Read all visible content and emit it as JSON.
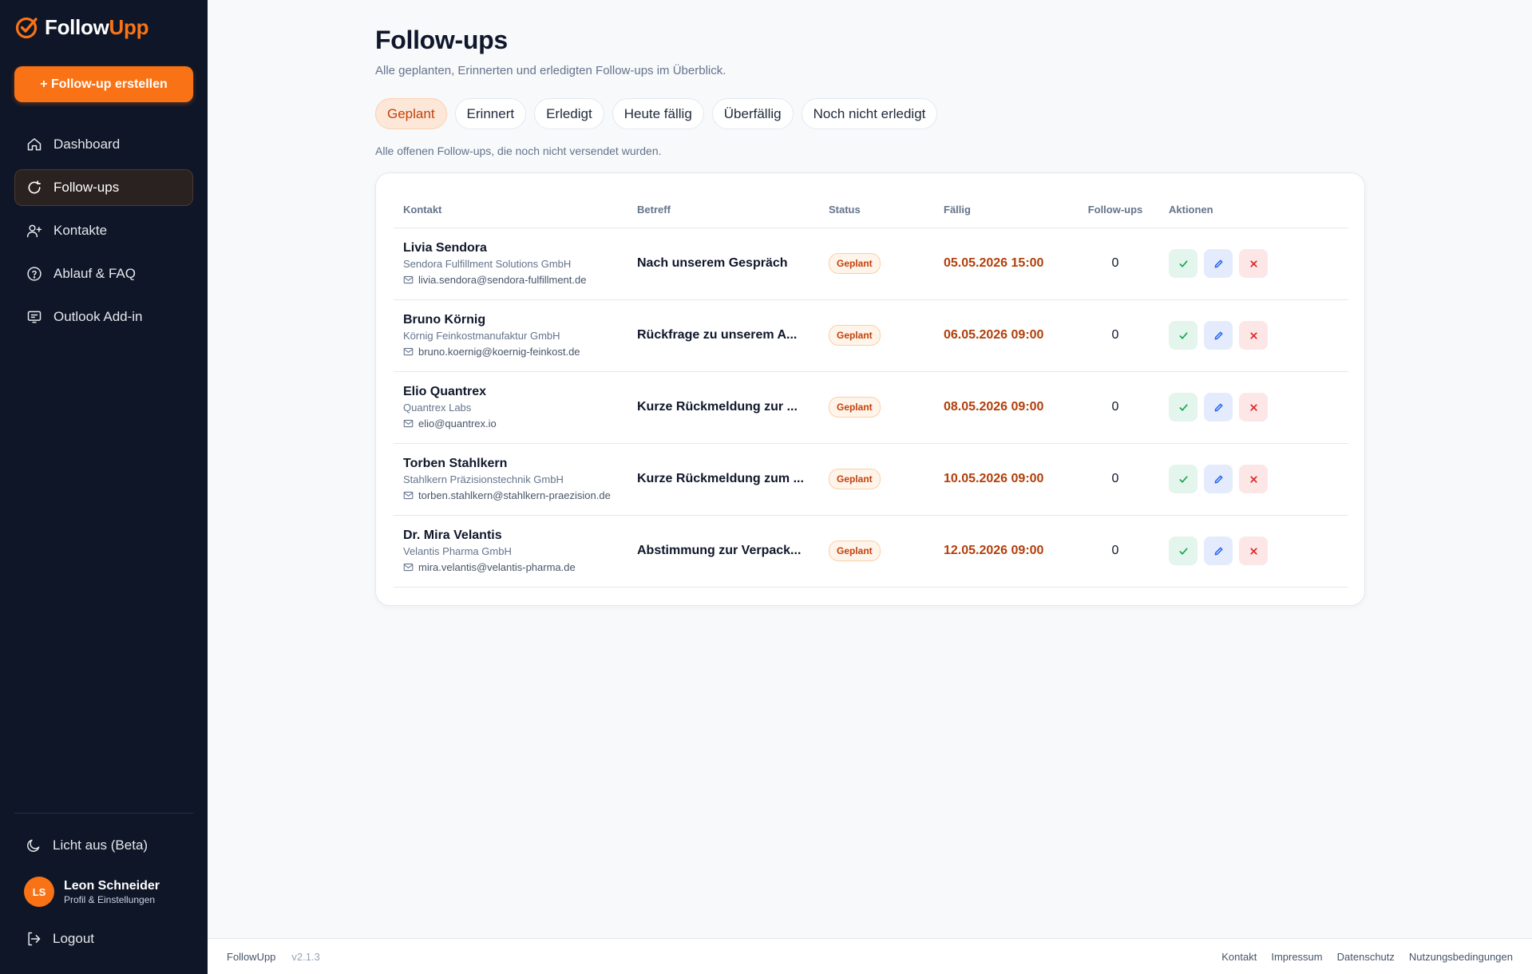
{
  "brand": {
    "name_part1": "Follow",
    "name_part2": "Upp",
    "accent": "#f97316"
  },
  "sidebar": {
    "create_button": "+ Follow-up erstellen",
    "items": [
      {
        "label": "Dashboard",
        "icon": "home-icon"
      },
      {
        "label": "Follow-ups",
        "icon": "refresh-icon",
        "active": true
      },
      {
        "label": "Kontakte",
        "icon": "user-plus-icon"
      },
      {
        "label": "Ablauf & FAQ",
        "icon": "help-circle-icon"
      },
      {
        "label": "Outlook Add-in",
        "icon": "outlook-icon"
      }
    ],
    "theme_toggle": "Licht aus (Beta)",
    "user": {
      "initials": "LS",
      "name": "Leon Schneider",
      "subtitle": "Profil & Einstellungen"
    },
    "logout": "Logout"
  },
  "page": {
    "title": "Follow-ups",
    "subtitle": "Alle geplanten, Erinnerten und erledigten Follow-ups im Überblick.",
    "tabs": [
      {
        "label": "Geplant",
        "active": true
      },
      {
        "label": "Erinnert"
      },
      {
        "label": "Erledigt"
      },
      {
        "label": "Heute fällig"
      },
      {
        "label": "Überfällig"
      },
      {
        "label": "Noch nicht erledigt"
      }
    ],
    "tab_description": "Alle offenen Follow-ups, die noch nicht versendet wurden."
  },
  "table": {
    "headers": [
      "Kontakt",
      "Betreff",
      "Status",
      "Fällig",
      "Follow-ups",
      "Aktionen"
    ],
    "rows": [
      {
        "name": "Livia Sendora",
        "company": "Sendora Fulfillment Solutions GmbH",
        "email": "livia.sendora@sendora-fulfillment.de",
        "subject": "Nach unserem Gespräch",
        "status": "Geplant",
        "due": "05.05.2026 15:00",
        "followups": "0"
      },
      {
        "name": "Bruno Körnig",
        "company": "Körnig Feinkostmanufaktur GmbH",
        "email": "bruno.koernig@koernig-feinkost.de",
        "subject": "Rückfrage zu unserem A...",
        "status": "Geplant",
        "due": "06.05.2026 09:00",
        "followups": "0"
      },
      {
        "name": "Elio Quantrex",
        "company": "Quantrex Labs",
        "email": "elio@quantrex.io",
        "subject": "Kurze Rückmeldung zur ...",
        "status": "Geplant",
        "due": "08.05.2026 09:00",
        "followups": "0"
      },
      {
        "name": "Torben Stahlkern",
        "company": "Stahlkern Präzisionstechnik GmbH",
        "email": "torben.stahlkern@stahlkern-praezision.de",
        "subject": "Kurze Rückmeldung zum ...",
        "status": "Geplant",
        "due": "10.05.2026 09:00",
        "followups": "0"
      },
      {
        "name": "Dr. Mira Velantis",
        "company": "Velantis Pharma GmbH",
        "email": "mira.velantis@velantis-pharma.de",
        "subject": "Abstimmung zur Verpack...",
        "status": "Geplant",
        "due": "12.05.2026 09:00",
        "followups": "0"
      }
    ]
  },
  "footer": {
    "app": "FollowUpp",
    "version": "v2.1.3",
    "links": [
      "Kontakt",
      "Impressum",
      "Datenschutz",
      "Nutzungsbedingungen"
    ]
  }
}
